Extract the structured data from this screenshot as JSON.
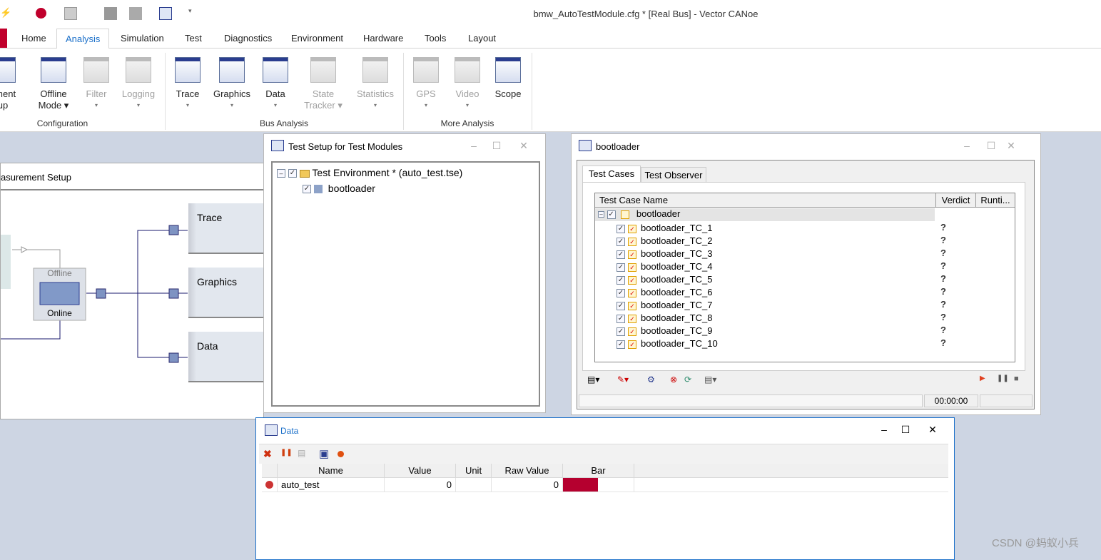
{
  "window_title": "bmw_AutoTestModule.cfg * [Real Bus] - Vector CANoe",
  "ribbon_tabs": [
    "Home",
    "Analysis",
    "Simulation",
    "Test",
    "Diagnostics",
    "Environment",
    "Hardware",
    "Tools",
    "Layout"
  ],
  "selected_tab": "Analysis",
  "ribbon": {
    "config_buttons": [
      {
        "l1": "ement",
        "l2": "up"
      },
      {
        "l1": "Offline",
        "l2": "Mode ▾"
      },
      {
        "l1": "Filter",
        "l2": "▾"
      },
      {
        "l1": "Logging",
        "l2": "▾"
      }
    ],
    "bus_buttons": [
      {
        "l1": "Trace",
        "l2": "▾"
      },
      {
        "l1": "Graphics",
        "l2": "▾"
      },
      {
        "l1": "Data",
        "l2": "▾"
      },
      {
        "l1": "State",
        "l2": "Tracker ▾"
      },
      {
        "l1": "Statistics",
        "l2": "▾"
      }
    ],
    "more_buttons": [
      {
        "l1": "GPS",
        "l2": "▾"
      },
      {
        "l1": "Video",
        "l2": "▾"
      },
      {
        "l1": "Scope",
        "l2": ""
      }
    ],
    "groups": [
      "Configuration",
      "Bus Analysis",
      "More Analysis"
    ]
  },
  "measurement_setup": {
    "title": "asurement Setup",
    "switch_top": "Offline",
    "switch_bottom": "Online",
    "blocks": [
      "Trace",
      "Graphics",
      "Data"
    ]
  },
  "test_setup": {
    "title": "Test Setup for Test Modules",
    "env": "Test Environment *  (auto_test.tse)",
    "module": "bootloader"
  },
  "bootloader": {
    "title": "bootloader",
    "tabs": [
      "Test Cases",
      "Test Observer"
    ],
    "columns": [
      "Test Case Name",
      "Verdict",
      "Runti..."
    ],
    "root": "bootloader",
    "cases": [
      "bootloader_TC_1",
      "bootloader_TC_2",
      "bootloader_TC_3",
      "bootloader_TC_4",
      "bootloader_TC_5",
      "bootloader_TC_6",
      "bootloader_TC_7",
      "bootloader_TC_8",
      "bootloader_TC_9",
      "bootloader_TC_10"
    ],
    "verdict_glyph": "?",
    "time": "00:00:00"
  },
  "data_window": {
    "title": "Data",
    "columns": [
      "Name",
      "Value",
      "Unit",
      "Raw Value",
      "Bar"
    ],
    "rows": [
      {
        "name": "auto_test",
        "value": "0",
        "unit": "",
        "raw": "0",
        "bar_color": "#b5002f"
      }
    ]
  },
  "watermark": "CSDN @蚂蚁小兵",
  "colors": {
    "accent_tab": "#1a6fc9",
    "brand_red": "#c0002c",
    "bar": "#b5002f"
  }
}
